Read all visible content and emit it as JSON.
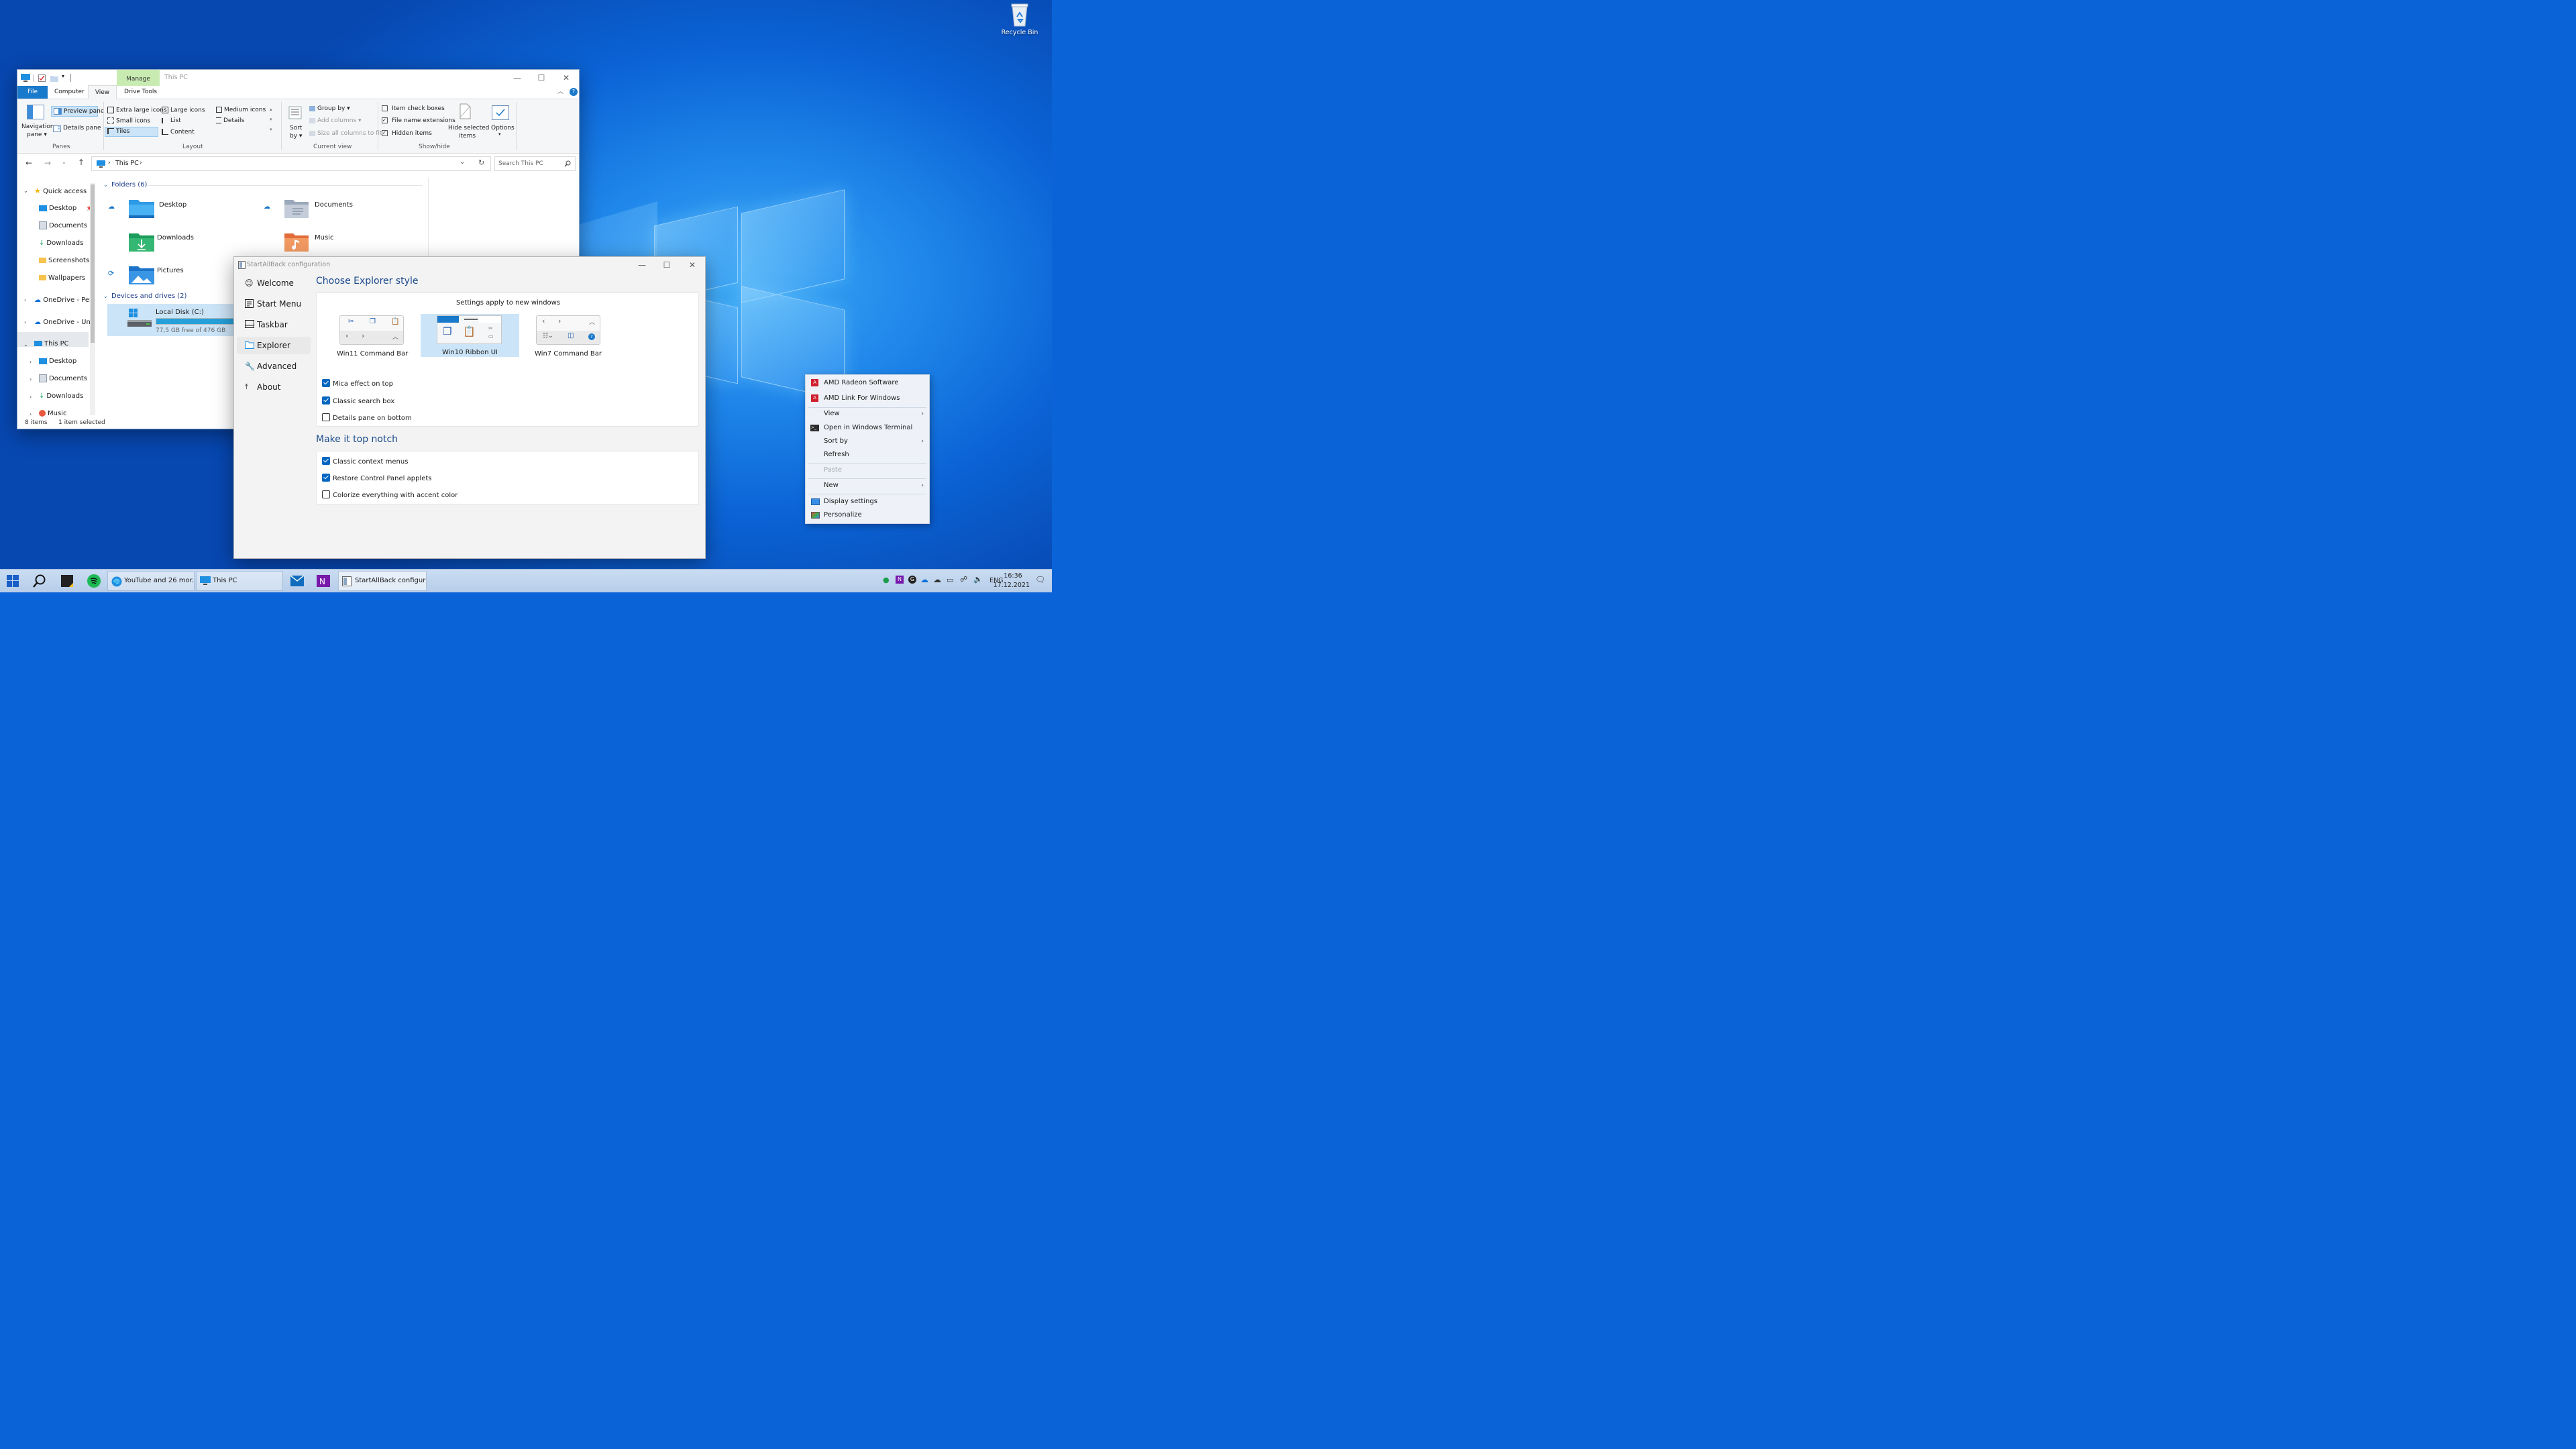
{
  "desktop": {
    "recycle_bin_label": "Recycle Bin"
  },
  "explorer": {
    "title": "This PC",
    "manage_tab": "Manage",
    "tabs": [
      "File",
      "Computer",
      "View",
      "Drive Tools"
    ],
    "ribbon": {
      "panes": {
        "navigation_pane": "Navigation",
        "navigation_pane2": "pane",
        "preview_pane": "Preview pane",
        "details_pane": "Details pane",
        "label": "Panes"
      },
      "layout": {
        "items": [
          "Extra large icons",
          "Large icons",
          "Medium icons",
          "Small icons",
          "List",
          "Details",
          "Tiles",
          "Content"
        ],
        "label": "Layout"
      },
      "current_view": {
        "sort_by": "Sort",
        "sort_by2": "by",
        "group_by": "Group by",
        "add_columns": "Add columns",
        "size_all_columns": "Size all columns to fit",
        "label": "Current view"
      },
      "show_hide": {
        "item_check_boxes": "Item check boxes",
        "file_name_extensions": "File name extensions",
        "hidden_items": "Hidden items",
        "hide_selected": "Hide selected",
        "hide_selected2": "items",
        "options": "Options",
        "label": "Show/hide"
      }
    },
    "address": {
      "path": "This PC",
      "search_placeholder": "Search This PC"
    },
    "nav": {
      "quick_access": "Quick access",
      "quick_items": [
        "Desktop",
        "Documents",
        "Downloads",
        "Screenshots",
        "Wallpapers"
      ],
      "onedrive_personal": "OneDrive - Per:",
      "onedrive_uni": "OneDrive - Uni",
      "this_pc": "This PC",
      "pc_items": [
        "Desktop",
        "Documents",
        "Downloads",
        "Music"
      ]
    },
    "content": {
      "folders_header": "Folders (6)",
      "folders": [
        "Desktop",
        "Documents",
        "Downloads",
        "Music",
        "Pictures"
      ],
      "devices_header": "Devices and drives (2)",
      "drive_name": "Local Disk (C:)",
      "drive_free": "77,5 GB free of 476 GB",
      "drive_used_fraction": 0.84
    },
    "status": {
      "items": "8 items",
      "selected": "1 item selected"
    }
  },
  "startallback": {
    "title": "StartAllBack configuration",
    "nav": [
      "Welcome",
      "Start Menu",
      "Taskbar",
      "Explorer",
      "Advanced",
      "About"
    ],
    "selected_nav": "Explorer",
    "heading1": "Choose Explorer style",
    "settings_note": "Settings apply to new windows",
    "styles": [
      "Win11 Command Bar",
      "Win10 Ribbon UI",
      "Win7 Command Bar"
    ],
    "selected_style": "Win10 Ribbon UI",
    "options1": [
      {
        "label": "Mica effect on top",
        "checked": true
      },
      {
        "label": "Classic search box",
        "checked": true
      },
      {
        "label": "Details pane on bottom",
        "checked": false
      }
    ],
    "heading2": "Make it top notch",
    "options2": [
      {
        "label": "Classic context menus",
        "checked": true
      },
      {
        "label": "Restore Control Panel applets",
        "checked": true
      },
      {
        "label": "Colorize everything with accent color",
        "checked": false
      }
    ],
    "accent_color": "#0067c0"
  },
  "context_menu": {
    "items": [
      {
        "label": "AMD Radeon Software"
      },
      {
        "label": "AMD Link For Windows"
      },
      {
        "label": "View"
      },
      {
        "label": "Open in Windows Terminal"
      },
      {
        "label": "Sort by"
      },
      {
        "label": "Refresh"
      },
      {
        "label": "Paste"
      },
      {
        "label": "New"
      },
      {
        "label": "Display settings"
      },
      {
        "label": "Personalize"
      }
    ]
  },
  "taskbar": {
    "tasks": [
      "YouTube and 26 mor...",
      "This PC",
      "StartAllBack configura..."
    ],
    "language": "ENG",
    "time": "16:36",
    "date": "17.12.2021"
  }
}
